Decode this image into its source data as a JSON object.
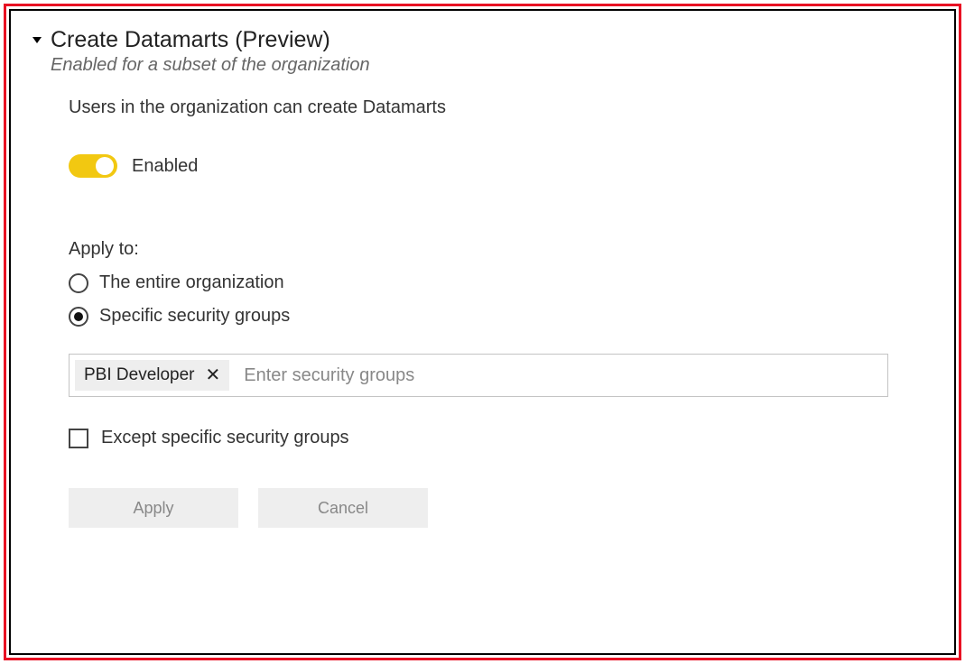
{
  "header": {
    "title": "Create Datamarts (Preview)",
    "subtitle": "Enabled for a subset of the organization"
  },
  "description": "Users in the organization can create Datamarts",
  "toggle": {
    "label": "Enabled",
    "state": "on"
  },
  "apply_to": {
    "label": "Apply to:",
    "options": {
      "entire_org": "The entire organization",
      "specific_groups": "Specific security groups"
    },
    "selected": "specific_groups"
  },
  "security_groups": {
    "chips": [
      "PBI Developer"
    ],
    "placeholder": "Enter security groups"
  },
  "except": {
    "label": "Except specific security groups",
    "checked": false
  },
  "buttons": {
    "apply": "Apply",
    "cancel": "Cancel"
  }
}
